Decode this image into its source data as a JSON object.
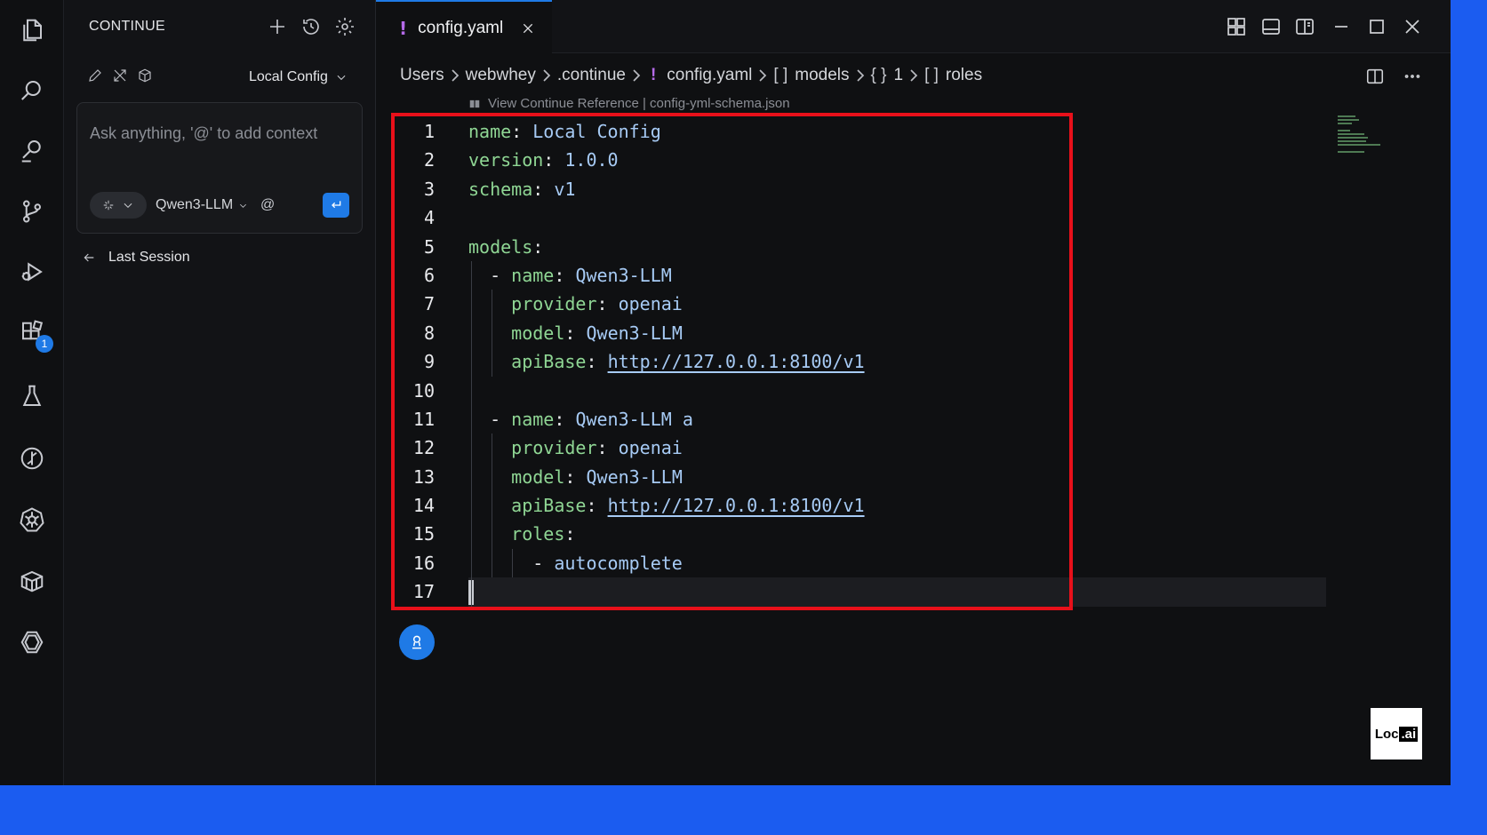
{
  "sidebar": {
    "title": "CONTINUE",
    "config_label": "Local Config",
    "chat_placeholder": "Ask anything, '@' to add context",
    "model_label": "Qwen3-LLM",
    "at_label": "@",
    "last_session_label": "Last Session"
  },
  "activity": {
    "extensions_badge": "1"
  },
  "editor": {
    "tab_label": "config.yaml",
    "tab_marker": "!",
    "breadcrumb": {
      "users": "Users",
      "webwhey": "webwhey",
      "continue": ".continue",
      "file_marker": "!",
      "file": "config.yaml",
      "models_bracket": "[ ]",
      "models": "models",
      "index_bracket": "{ }",
      "index": "1",
      "roles_bracket": "[ ]",
      "roles": "roles"
    },
    "codelens": "View Continue Reference | config-yml-schema.json",
    "lines": [
      {
        "n": "1",
        "key": "name",
        "value": "Local Config",
        "indent": ""
      },
      {
        "n": "2",
        "key": "version",
        "value": "1.0.0",
        "indent": ""
      },
      {
        "n": "3",
        "key": "schema",
        "value": "v1",
        "indent": ""
      },
      {
        "n": "4",
        "key": "",
        "value": "",
        "indent": ""
      },
      {
        "n": "5",
        "key": "models",
        "value": "",
        "indent": ""
      },
      {
        "n": "6",
        "key": "name",
        "value": "Qwen3-LLM",
        "indent": "  - "
      },
      {
        "n": "7",
        "key": "provider",
        "value": "openai",
        "indent": "    "
      },
      {
        "n": "8",
        "key": "model",
        "value": "Qwen3-LLM",
        "indent": "    "
      },
      {
        "n": "9",
        "key": "apiBase",
        "value": "http://127.0.0.1:8100/v1",
        "indent": "    ",
        "link": true
      },
      {
        "n": "10",
        "key": "",
        "value": "",
        "indent": ""
      },
      {
        "n": "11",
        "key": "name",
        "value": "Qwen3-LLM a",
        "indent": "  - "
      },
      {
        "n": "12",
        "key": "provider",
        "value": "openai",
        "indent": "    "
      },
      {
        "n": "13",
        "key": "model",
        "value": "Qwen3-LLM",
        "indent": "    "
      },
      {
        "n": "14",
        "key": "apiBase",
        "value": "http://127.0.0.1:8100/v1",
        "indent": "    ",
        "link": true
      },
      {
        "n": "15",
        "key": "roles",
        "value": "",
        "indent": "    "
      },
      {
        "n": "16",
        "key": "",
        "value": "autocomplete",
        "indent": "      - "
      },
      {
        "n": "17",
        "key": "",
        "value": "",
        "indent": "",
        "current": true
      }
    ]
  },
  "watermark": {
    "text_a": "Loc",
    "text_b": ".ai"
  },
  "colors": {
    "accent": "#1f7ae6",
    "highlight_box": "#e8101a",
    "yaml_key": "#8fd694",
    "yaml_value": "#a7cbf5",
    "background": "#1b5cf0"
  }
}
